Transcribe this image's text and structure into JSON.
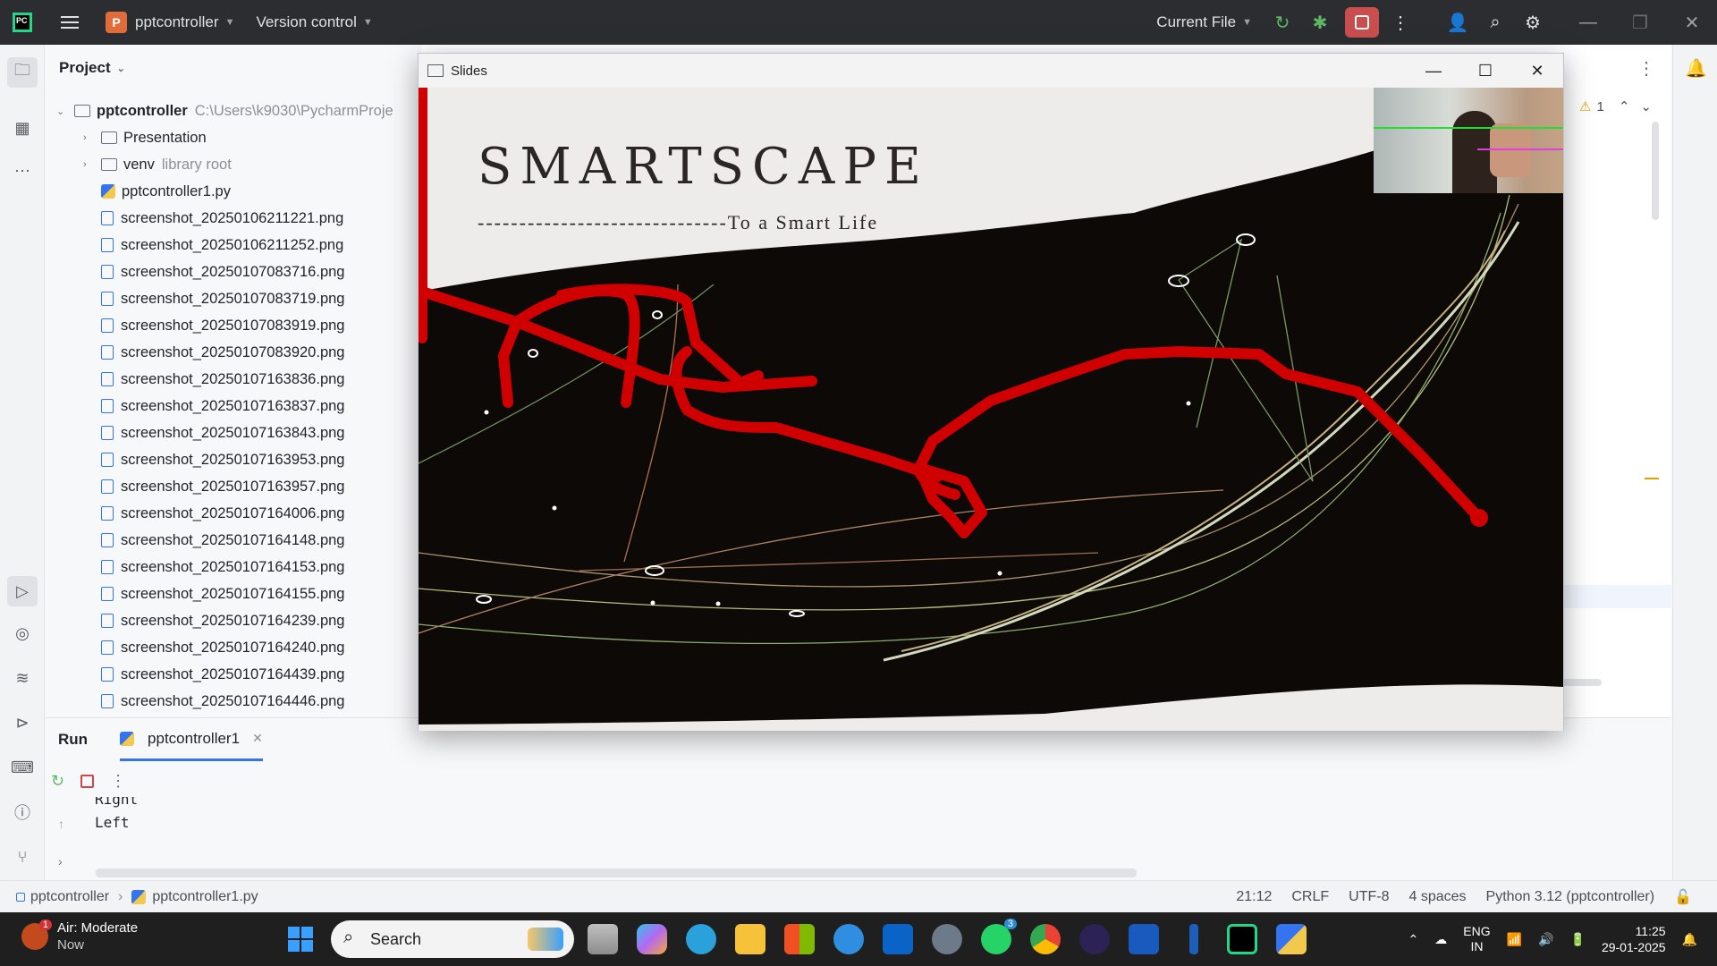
{
  "titlebar": {
    "project_badge": "P",
    "project_name": "pptcontroller",
    "vcs_menu": "Version control",
    "run_config": "Current File"
  },
  "project_panel": {
    "title": "Project",
    "root": {
      "name": "pptcontroller",
      "path": "C:\\Users\\k9030\\PycharmProje"
    },
    "folders": [
      {
        "name": "Presentation",
        "note": ""
      },
      {
        "name": "venv",
        "note": "library root"
      }
    ],
    "files": [
      "pptcontroller1.py",
      "screenshot_20250106211221.png",
      "screenshot_20250106211252.png",
      "screenshot_20250107083716.png",
      "screenshot_20250107083719.png",
      "screenshot_20250107083919.png",
      "screenshot_20250107083920.png",
      "screenshot_20250107163836.png",
      "screenshot_20250107163837.png",
      "screenshot_20250107163843.png",
      "screenshot_20250107163953.png",
      "screenshot_20250107163957.png",
      "screenshot_20250107164006.png",
      "screenshot_20250107164148.png",
      "screenshot_20250107164153.png",
      "screenshot_20250107164155.png",
      "screenshot_20250107164239.png",
      "screenshot_20250107164240.png",
      "screenshot_20250107164439.png",
      "screenshot_20250107164446.png"
    ]
  },
  "editor": {
    "warnings": "1"
  },
  "run_panel": {
    "title": "Run",
    "tab": "pptcontroller1",
    "console": [
      "Right",
      "Left"
    ]
  },
  "statusbar": {
    "breadcrumb_project": "pptcontroller",
    "breadcrumb_file": "pptcontroller1.py",
    "position": "21:12",
    "line_sep": "CRLF",
    "encoding": "UTF-8",
    "indent": "4 spaces",
    "interpreter": "Python 3.12 (pptcontroller)"
  },
  "slides_window": {
    "title": "Slides",
    "slide_title": "SMARTSCAPE",
    "slide_subtitle": "------------------------------To a Smart Life"
  },
  "taskbar": {
    "weather_title": "Air: Moderate",
    "weather_sub": "Now",
    "weather_badge": "1",
    "search_placeholder": "Search",
    "whatsapp_badge": "3",
    "lang_top": "ENG",
    "lang_bottom": "IN",
    "time": "11:25",
    "date": "29-01-2025"
  },
  "colors": {
    "ide_dark": "#2b2d30",
    "accent_blue": "#3574f0",
    "stop_red": "#c94f4f",
    "annotation_red": "#d10000"
  }
}
